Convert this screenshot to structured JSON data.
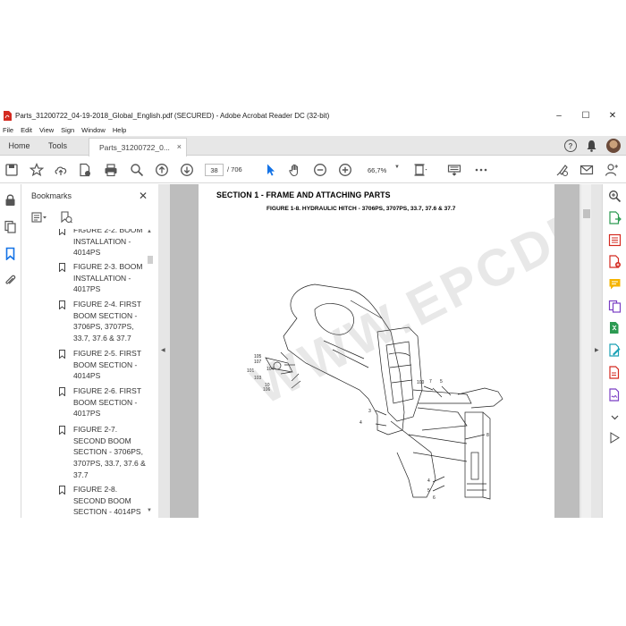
{
  "window": {
    "title": "Parts_31200722_04-19-2018_Global_English.pdf (SECURED) - Adobe Acrobat Reader DC (32-bit)",
    "controls": {
      "minimize": "–",
      "maximize": "☐",
      "close": "✕"
    }
  },
  "menu": [
    "File",
    "Edit",
    "View",
    "Sign",
    "Window",
    "Help"
  ],
  "tabs": {
    "home": "Home",
    "tools": "Tools",
    "document": "Parts_31200722_0...",
    "close": "×",
    "help": "?"
  },
  "toolbar": {
    "current_page": "38",
    "total_pages": "/ 706",
    "zoom": "66,7%"
  },
  "bookmarks": {
    "header": "Bookmarks",
    "close": "✕",
    "items": [
      "FIGURE 2-2. BOOM INSTALLATION - 4014PS",
      "FIGURE 2-3. BOOM INSTALLATION - 4017PS",
      "FIGURE 2-4. FIRST BOOM SECTION - 3706PS, 3707PS, 33.7, 37.6 & 37.7",
      "FIGURE 2-5. FIRST BOOM SECTION - 4014PS",
      "FIGURE 2-6. FIRST BOOM SECTION - 4017PS",
      "FIGURE 2-7. SECOND BOOM SECTION - 3706PS, 3707PS, 33.7, 37.6 & 37.7",
      "FIGURE 2-8. SECOND BOOM SECTION - 4014PS"
    ]
  },
  "document": {
    "section_title": "SECTION 1 - FRAME AND ATTACHING PARTS",
    "figure_title": "FIGURE 1-8. HYDRAULIC HITCH - 3706PS, 3707PS, 33.7, 37.6 & 37.7",
    "watermark": "WWW.EPCDEPO.COM",
    "callouts": [
      "105",
      "107",
      "101",
      "104",
      "103",
      "10",
      "106",
      "100",
      "7",
      "5",
      "3",
      "4",
      "8",
      "4",
      "5",
      "6"
    ]
  },
  "colors": {
    "accent_blue": "#1473e6",
    "pdf_red": "#d42a20",
    "tab_bg": "#e7e7e7"
  }
}
